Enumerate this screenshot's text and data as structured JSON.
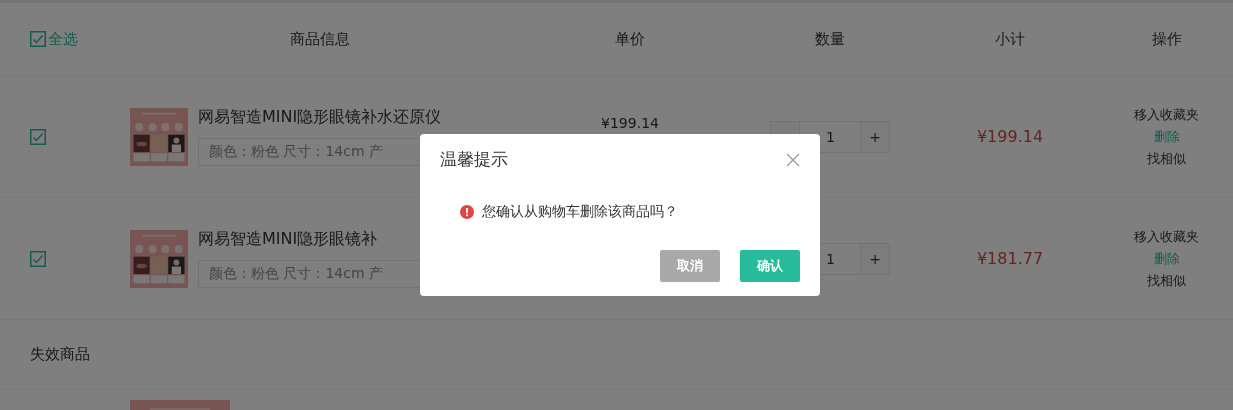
{
  "header": {
    "select_all": {
      "label": "全选",
      "checked": true
    },
    "columns": [
      "商品信息",
      "单价",
      "数量",
      "小计",
      "操作"
    ]
  },
  "items": [
    {
      "checked": true,
      "name": "网易智造MINI隐形眼镜补水还原仪",
      "spec": "颜色：粉色 尺寸：14cm 产",
      "price": "¥199.14",
      "quantity": {
        "value": "1",
        "plus": "+"
      },
      "subtotal": "¥199.14",
      "actions": [
        {
          "label": "移入收藏夹",
          "kind": "plain"
        },
        {
          "label": "删除",
          "kind": "primary"
        },
        {
          "label": "找相似",
          "kind": "plain"
        }
      ]
    },
    {
      "checked": true,
      "name": "网易智造MINI隐形眼镜补",
      "spec": "颜色：粉色 尺寸：14cm 产",
      "quantity": {
        "value": "1",
        "plus": "+"
      },
      "subtotal": "¥181.77",
      "actions": [
        {
          "label": "移入收藏夹",
          "kind": "plain"
        },
        {
          "label": "删除",
          "kind": "primary"
        },
        {
          "label": "找相似",
          "kind": "plain"
        }
      ]
    }
  ],
  "invalid_section": {
    "title": "失效商品"
  },
  "dialog": {
    "title": "温馨提示",
    "message": "您确认从购物车删除该商品吗？",
    "buttons": [
      {
        "label": "取消",
        "kind": "cancel"
      },
      {
        "label": "确认",
        "kind": "confirm"
      }
    ]
  }
}
